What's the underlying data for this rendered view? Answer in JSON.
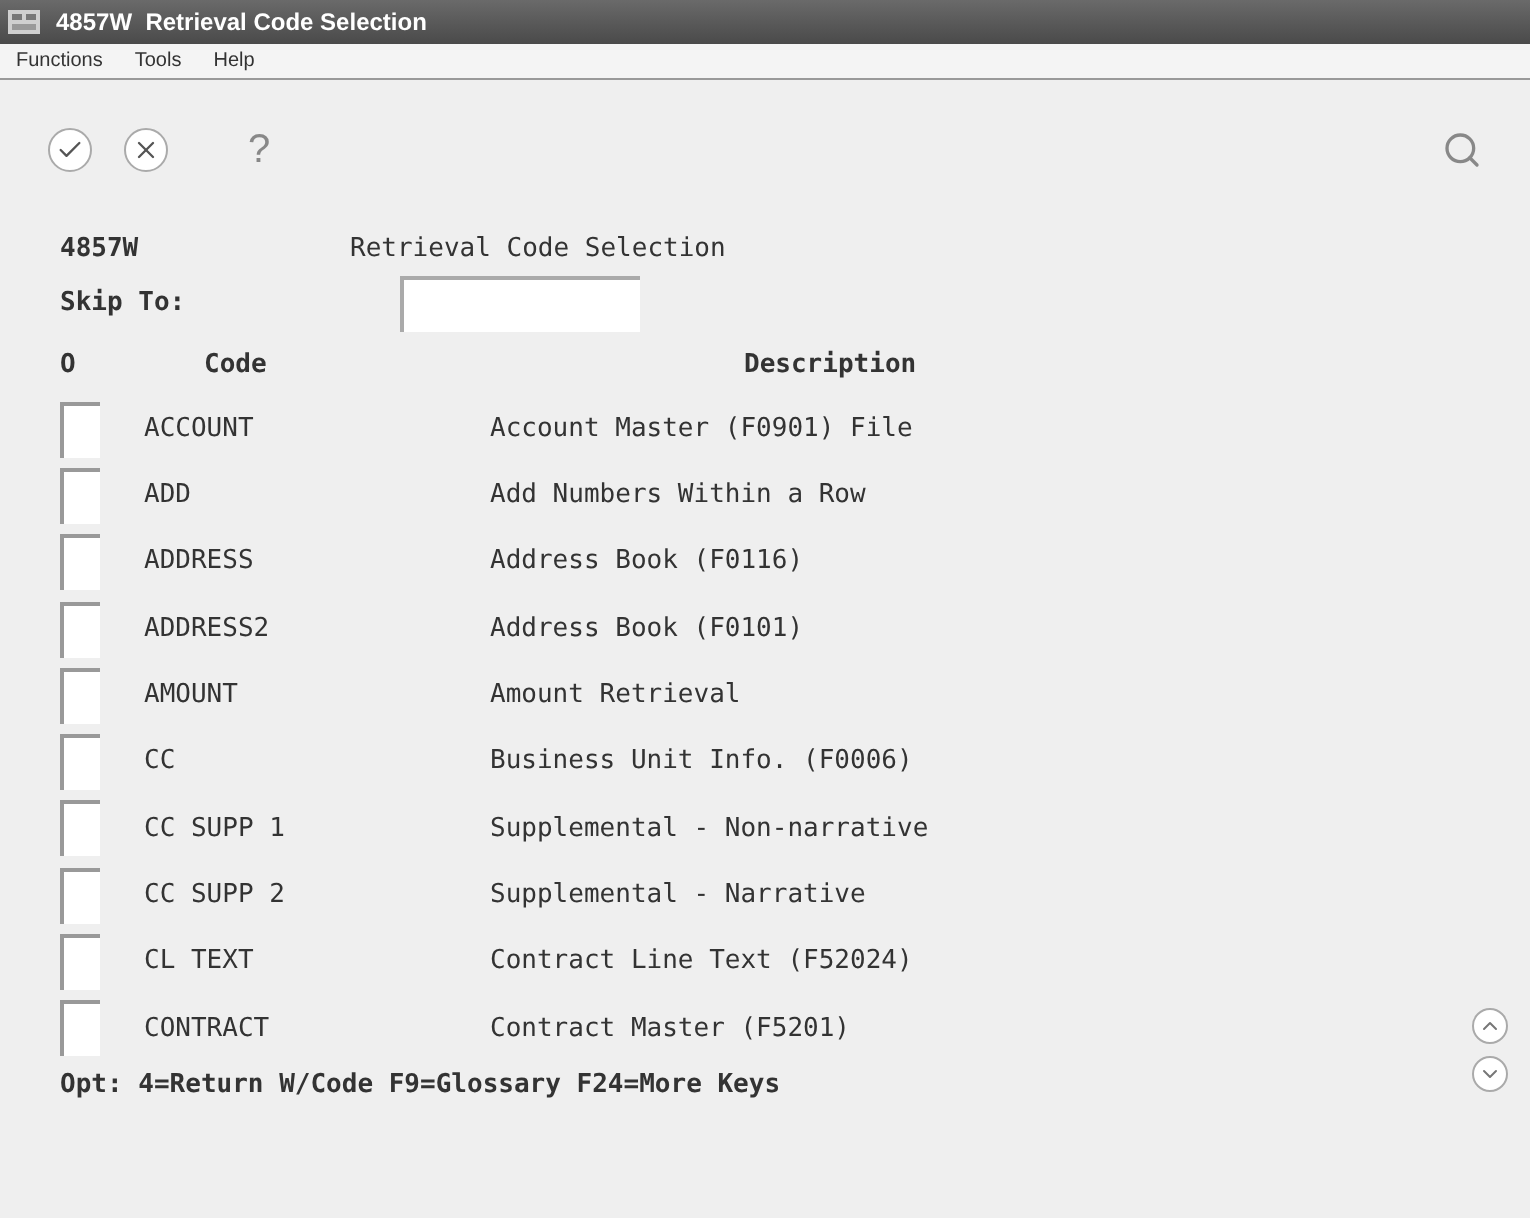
{
  "window": {
    "title": "4857W  Retrieval Code Selection"
  },
  "menu": [
    "Functions",
    "Tools",
    "Help"
  ],
  "toolbar": {
    "help": "?"
  },
  "form": {
    "id": "4857W",
    "title": "Retrieval Code Selection",
    "skip_label": "Skip To:"
  },
  "table": {
    "columns": [
      "O",
      "Code",
      "Description"
    ],
    "rows": [
      {
        "code": "ACCOUNT",
        "description": "Account Master (F0901) File"
      },
      {
        "code": "ADD",
        "description": "Add Numbers Within a Row"
      },
      {
        "code": "ADDRESS",
        "description": "Address Book (F0116)"
      },
      {
        "code": "ADDRESS2",
        "description": "Address Book (F0101)"
      },
      {
        "code": "AMOUNT",
        "description": "Amount Retrieval"
      },
      {
        "code": "CC",
        "description": "Business Unit Info. (F0006)"
      },
      {
        "code": "CC SUPP 1",
        "description": "Supplemental - Non-narrative"
      },
      {
        "code": "CC SUPP 2",
        "description": "Supplemental - Narrative"
      },
      {
        "code": "CL TEXT",
        "description": "Contract Line Text (F52024)"
      },
      {
        "code": "CONTRACT",
        "description": "Contract Master (F5201)"
      }
    ]
  },
  "footer": "Opt: 4=Return W/Code F9=Glossary F24=More Keys"
}
